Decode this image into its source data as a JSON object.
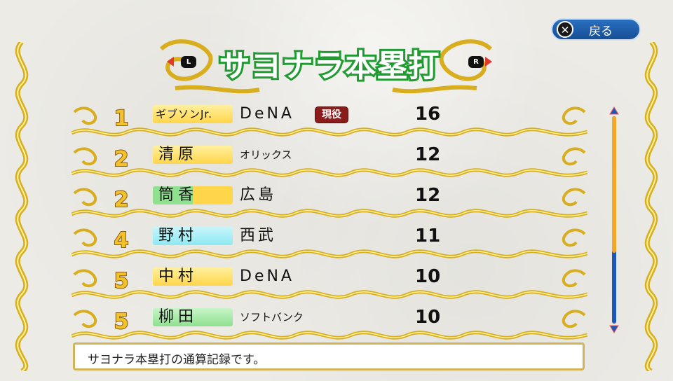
{
  "back_button": {
    "label": "戻る",
    "icon": "x-button-icon"
  },
  "title": "サヨナラ本塁打",
  "nav": {
    "left_label": "L",
    "right_label": "R"
  },
  "colors": {
    "title_green": "#1f9b32",
    "badge_yellow": "#ffd64a",
    "badge_green": "#8fe08f",
    "badge_cyan": "#8ee8f2",
    "active_red": "#8b1c1c",
    "scroll_blue": "#1d58b8",
    "scroll_orange": "#f1a728"
  },
  "rows": [
    {
      "rank": "1",
      "name": "ギブソンJr.",
      "team": "DeNA",
      "count": "16",
      "badge": "現役",
      "name_style": "yellow"
    },
    {
      "rank": "2",
      "name": "清原",
      "team": "オリックス",
      "count": "12",
      "badge": "",
      "name_style": "yellow"
    },
    {
      "rank": "2",
      "name": "筒香",
      "team": "広島",
      "count": "12",
      "badge": "",
      "name_style": "green-yellow"
    },
    {
      "rank": "4",
      "name": "野村",
      "team": "西武",
      "count": "11",
      "badge": "",
      "name_style": "cyan"
    },
    {
      "rank": "5",
      "name": "中村",
      "team": "DeNA",
      "count": "10",
      "badge": "",
      "name_style": "yellow"
    },
    {
      "rank": "5",
      "name": "柳田",
      "team": "ソフトバンク",
      "count": "10",
      "badge": "",
      "name_style": "green"
    }
  ],
  "scroll": {
    "position_fraction": 0.66
  },
  "description": "サヨナラ本塁打の通算記録です。"
}
